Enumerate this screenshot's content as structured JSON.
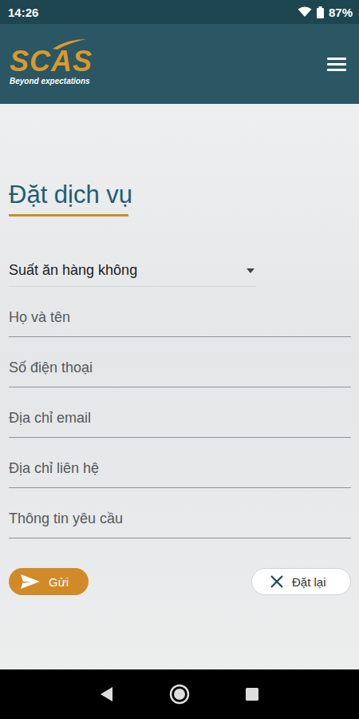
{
  "status_bar": {
    "time": "14:26",
    "battery": "87%"
  },
  "header": {
    "logo": "SCAS",
    "tagline": "Beyond expectations"
  },
  "form": {
    "title": "Đặt dịch vụ",
    "service": {
      "value": "Suất ăn hàng không",
      "expanded": false
    },
    "fields": [
      {
        "placeholder": "Họ và tên"
      },
      {
        "placeholder": "Số điện thoại"
      },
      {
        "placeholder": "Địa chỉ email"
      },
      {
        "placeholder": "Địa chỉ liên hệ"
      },
      {
        "placeholder": "Thông tin yêu cầu"
      }
    ]
  },
  "buttons": [
    {
      "label": "Gửi",
      "kind": "primary"
    },
    {
      "label": "Đặt lại",
      "kind": "secondary"
    }
  ]
}
